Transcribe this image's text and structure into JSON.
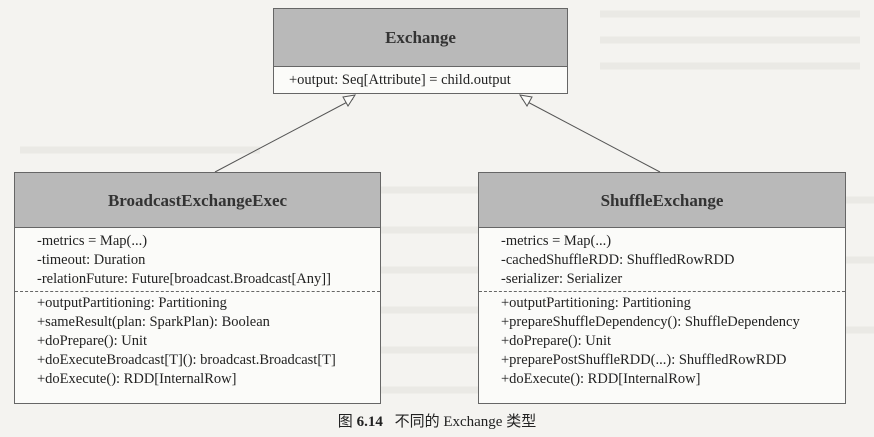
{
  "classes": {
    "exchange": {
      "name": "Exchange",
      "fields": [
        "+output: Seq[Attribute] = child.output"
      ]
    },
    "broadcast": {
      "name": "BroadcastExchangeExec",
      "fields": [
        "-metrics = Map(...)",
        "-timeout: Duration",
        "-relationFuture: Future[broadcast.Broadcast[Any]]"
      ],
      "methods": [
        "+outputPartitioning: Partitioning",
        "+sameResult(plan: SparkPlan): Boolean",
        "+doPrepare(): Unit",
        "+doExecuteBroadcast[T](): broadcast.Broadcast[T]",
        "+doExecute(): RDD[InternalRow]"
      ]
    },
    "shuffle": {
      "name": "ShuffleExchange",
      "fields": [
        "-metrics = Map(...)",
        "-cachedShuffleRDD: ShuffledRowRDD",
        "-serializer: Serializer"
      ],
      "methods": [
        "+outputPartitioning: Partitioning",
        "+prepareShuffleDependency(): ShuffleDependency",
        "+doPrepare(): Unit",
        "+preparePostShuffleRDD(...): ShuffledRowRDD",
        "+doExecute(): RDD[InternalRow]"
      ]
    }
  },
  "caption": {
    "prefix": "图",
    "number": "6.14",
    "text": "不同的 Exchange 类型"
  }
}
